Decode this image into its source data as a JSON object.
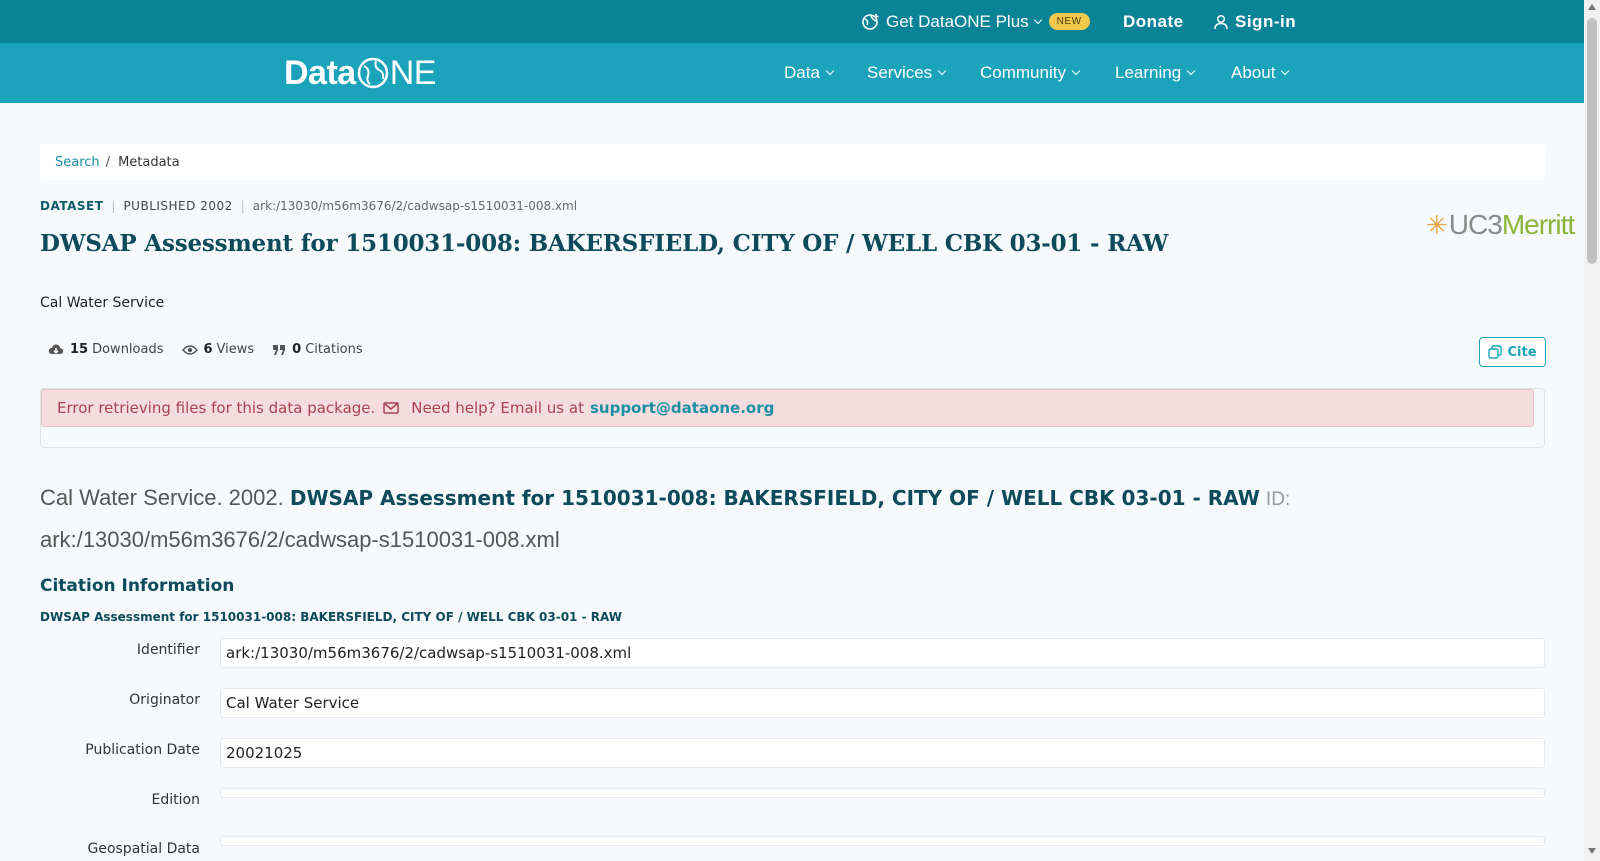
{
  "topbar": {
    "plus_label": "Get DataONE Plus",
    "new_badge": "NEW",
    "donate": "Donate",
    "signin": "Sign-in"
  },
  "nav": {
    "logo_a": "Data",
    "logo_b": "NE",
    "items": [
      "Data",
      "Services",
      "Community",
      "Learning",
      "About"
    ]
  },
  "breadcrumb": {
    "search": "Search",
    "sep": "/",
    "current": "Metadata"
  },
  "meta": {
    "type": "DATASET",
    "published": "PUBLISHED 2002",
    "id": "ark:/13030/m56m3676/2/cadwsap-s1510031-008.xml"
  },
  "repo_logo": {
    "uc3": "UC3",
    "merritt": "Merritt"
  },
  "title": "DWSAP Assessment for 1510031-008: BAKERSFIELD, CITY OF / WELL CBK 03-01 - RAW",
  "creator": "Cal Water Service",
  "metrics": {
    "downloads_count": "15",
    "downloads_label": "Downloads",
    "views_count": "6",
    "views_label": "Views",
    "citations_count": "0",
    "citations_label": "Citations"
  },
  "cite_button": "Cite",
  "alert": {
    "message": "Error retrieving files for this data package.",
    "help": "Need help? Email us at",
    "email": "support@dataone.org"
  },
  "citation": {
    "authors_year": "Cal Water Service. 2002.",
    "title": "DWSAP Assessment for 1510031-008: BAKERSFIELD, CITY OF / WELL CBK 03-01 - RAW",
    "id_label": "ID:",
    "id": "ark:/13030/m56m3676/2/cadwsap-s1510031-008.xml"
  },
  "section": {
    "heading": "Citation Information",
    "subtitle": "DWSAP Assessment for 1510031-008: BAKERSFIELD, CITY OF / WELL CBK 03-01 - RAW",
    "fields": [
      {
        "label": "Identifier",
        "value": "ark:/13030/m56m3676/2/cadwsap-s1510031-008.xml"
      },
      {
        "label": "Originator",
        "value": "Cal Water Service"
      },
      {
        "label": "Publication Date",
        "value": "20021025"
      },
      {
        "label": "Edition",
        "value": ""
      },
      {
        "label": "Geospatial Data",
        "value": ""
      }
    ]
  },
  "colors": {
    "topbar": "#0b8397",
    "navbar": "#1aa3ba",
    "title": "#0c4a5c",
    "link": "#1b8fa3",
    "alert_bg": "#f4dcdf",
    "alert_text": "#a94452"
  }
}
